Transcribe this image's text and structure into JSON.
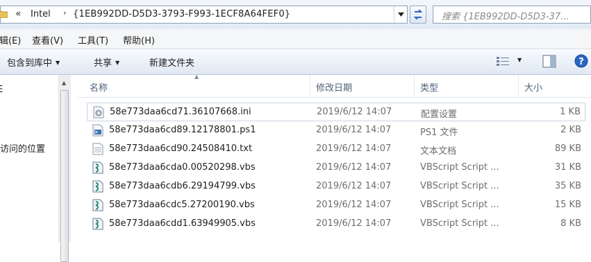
{
  "address": {
    "back_glyph": "«",
    "crumb_1": "Intel",
    "separator": "›",
    "crumb_2": "{1EB992DD-D5D3-3793-F993-1ECF8A64FEF0}"
  },
  "search": {
    "placeholder": "搜索 {1EB992DD-D5D3-37..."
  },
  "menu": [
    {
      "label": "辑(E)"
    },
    {
      "label": "查看(V)"
    },
    {
      "label": "工具(T)"
    },
    {
      "label": "帮助(H)"
    }
  ],
  "toolbar": {
    "include_library": "包含到库中",
    "share": "共享",
    "new_folder": "新建文件夹"
  },
  "nav": {
    "item_partial": "E",
    "recent_places": "访问的位置"
  },
  "columns": {
    "name": "名称",
    "modified": "修改日期",
    "type": "类型",
    "size": "大小"
  },
  "files": [
    {
      "name": "58e773daa6cd71.36107668.ini",
      "modified": "2019/6/12 14:07",
      "type": "配置设置",
      "size": "1 KB",
      "icon": "ini-settings-icon"
    },
    {
      "name": "58e773daa6cd89.12178801.ps1",
      "modified": "2019/6/12 14:07",
      "type": "PS1 文件",
      "size": "2 KB",
      "icon": "ps1-file-icon"
    },
    {
      "name": "58e773daa6cd90.24508410.txt",
      "modified": "2019/6/12 14:07",
      "type": "文本文档",
      "size": "89 KB",
      "icon": "text-document-icon"
    },
    {
      "name": "58e773daa6cda0.00520298.vbs",
      "modified": "2019/6/12 14:07",
      "type": "VBScript Script ...",
      "size": "31 KB",
      "icon": "vbscript-icon"
    },
    {
      "name": "58e773daa6cdb6.29194799.vbs",
      "modified": "2019/6/12 14:07",
      "type": "VBScript Script ...",
      "size": "35 KB",
      "icon": "vbscript-icon"
    },
    {
      "name": "58e773daa6cdc5.27200190.vbs",
      "modified": "2019/6/12 14:07",
      "type": "VBScript Script ...",
      "size": "15 KB",
      "icon": "vbscript-icon"
    },
    {
      "name": "58e773daa6cdd1.63949905.vbs",
      "modified": "2019/6/12 14:07",
      "type": "VBScript Script ...",
      "size": "8 KB",
      "icon": "vbscript-icon"
    }
  ],
  "colors": {
    "chrome_top": "#f3f7fc",
    "chrome_bottom": "#e2ebf6",
    "header_text": "#4c607a",
    "help_blue": "#2a64c5"
  }
}
